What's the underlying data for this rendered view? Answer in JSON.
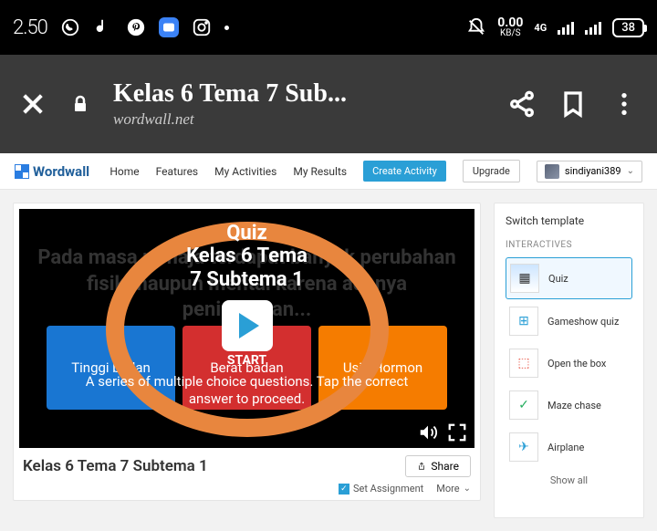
{
  "statusbar": {
    "time": "2.50",
    "kbs_value": "0.00",
    "kbs_label": "KB/S",
    "signal": "4G",
    "battery": "38"
  },
  "browser": {
    "title": "Kelas 6 Tema 7 Sub...",
    "host": "wordwall.net"
  },
  "nav": {
    "brand": "Wordwall",
    "links": [
      "Home",
      "Features",
      "My Activities",
      "My Results"
    ],
    "create": "Create Activity",
    "upgrade": "Upgrade",
    "user": "sindiyani389"
  },
  "game": {
    "bg_text": "Pada masa remaja terdapat banyak perubahan fisik maupun mental karena adanya peningkatan...",
    "options": [
      "Tinggi badan",
      "Berat badan",
      "Usia Hormon"
    ],
    "overlay": {
      "quiz": "Quiz",
      "title_line1": "Kelas 6 Tema",
      "title_line2": "7 Subtema 1",
      "start": "START",
      "desc": "A series of multiple choice questions. Tap the correct answer to proceed."
    }
  },
  "card": {
    "title": "Kelas 6 Tema 7 Subtema 1",
    "share": "Share",
    "set_assignment": "Set Assignment",
    "more": "More"
  },
  "sidebar": {
    "switch": "Switch template",
    "section": "INTERACTIVES",
    "templates": [
      "Quiz",
      "Gameshow quiz",
      "Open the box",
      "Maze chase",
      "Airplane"
    ],
    "show_all": "Show all"
  }
}
